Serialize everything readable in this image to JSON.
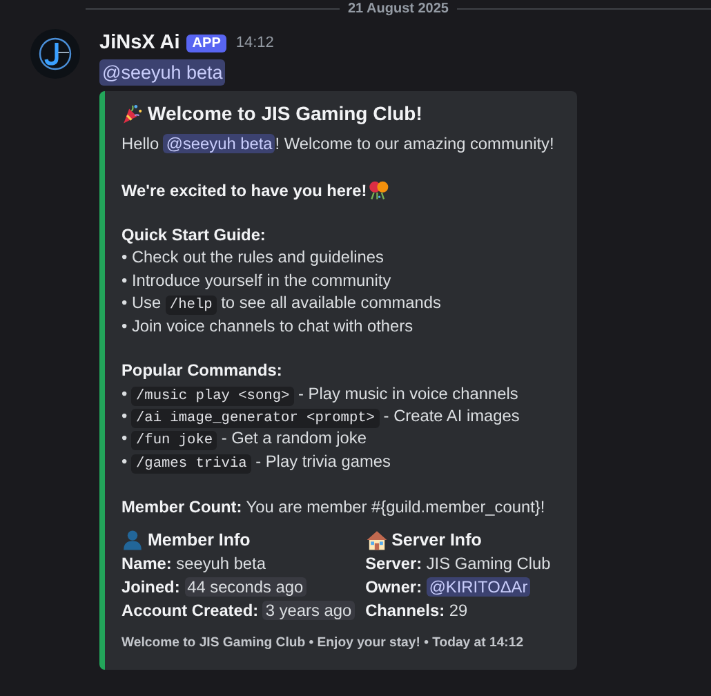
{
  "divider": {
    "date": "21 August 2025"
  },
  "message": {
    "author": "JiNsX Ai",
    "badge": "APP",
    "time": "14:12",
    "mention": "@seeyuh beta",
    "embed": {
      "title": "Welcome to JIS Gaming Club!",
      "lines": [
        {
          "kind": "line",
          "parts": [
            {
              "kind": "text",
              "text": "Hello "
            },
            {
              "kind": "mention",
              "text": "@seeyuh beta"
            },
            {
              "kind": "text",
              "text": "! Welcome to our amazing community!"
            }
          ]
        },
        {
          "kind": "gap"
        },
        {
          "kind": "line",
          "parts": [
            {
              "kind": "bold",
              "text": "We're excited to have you here!"
            },
            {
              "kind": "emoji"
            }
          ]
        },
        {
          "kind": "gap"
        },
        {
          "kind": "line",
          "parts": [
            {
              "kind": "bold",
              "text": "Quick Start Guide:"
            }
          ]
        },
        {
          "kind": "line",
          "parts": [
            {
              "kind": "text",
              "text": "• Check out the rules and guidelines"
            }
          ]
        },
        {
          "kind": "line",
          "parts": [
            {
              "kind": "text",
              "text": "• Introduce yourself in the community"
            }
          ]
        },
        {
          "kind": "line",
          "parts": [
            {
              "kind": "text",
              "text": "• Use "
            },
            {
              "kind": "code",
              "text": "/help"
            },
            {
              "kind": "text",
              "text": " to see all available commands"
            }
          ]
        },
        {
          "kind": "line",
          "parts": [
            {
              "kind": "text",
              "text": "• Join voice channels to chat with others"
            }
          ]
        },
        {
          "kind": "gap"
        },
        {
          "kind": "line",
          "parts": [
            {
              "kind": "bold",
              "text": "Popular Commands:"
            }
          ]
        },
        {
          "kind": "line",
          "parts": [
            {
              "kind": "text",
              "text": "• "
            },
            {
              "kind": "code",
              "text": "/music play <song>"
            },
            {
              "kind": "text",
              "text": " - Play music in voice channels"
            }
          ]
        },
        {
          "kind": "line",
          "parts": [
            {
              "kind": "text",
              "text": "• "
            },
            {
              "kind": "code",
              "text": "/ai image_generator <prompt>"
            },
            {
              "kind": "text",
              "text": " - Create AI images"
            }
          ]
        },
        {
          "kind": "line",
          "parts": [
            {
              "kind": "text",
              "text": "• "
            },
            {
              "kind": "code",
              "text": "/fun joke"
            },
            {
              "kind": "text",
              "text": " - Get a random joke"
            }
          ]
        },
        {
          "kind": "line",
          "parts": [
            {
              "kind": "text",
              "text": "• "
            },
            {
              "kind": "code",
              "text": "/games trivia"
            },
            {
              "kind": "text",
              "text": " - Play trivia games"
            }
          ]
        },
        {
          "kind": "gap"
        },
        {
          "kind": "line",
          "parts": [
            {
              "kind": "bold",
              "text": "Member Count:"
            },
            {
              "kind": "text",
              "text": " You are member #{guild.member_count}!"
            }
          ]
        }
      ],
      "fields": [
        {
          "name": "Member Info",
          "rows": [
            {
              "label": "Name:",
              "kind": "text",
              "value": "seeyuh beta"
            },
            {
              "label": "Joined:",
              "kind": "time",
              "value": "44 seconds ago"
            },
            {
              "label": "Account Created:",
              "kind": "time",
              "value": "3 years ago"
            }
          ]
        },
        {
          "name": "Server Info",
          "rows": [
            {
              "label": "Server:",
              "kind": "text",
              "value": "JIS Gaming Club"
            },
            {
              "label": "Owner:",
              "kind": "mention",
              "value": "@KIRITOΔAr"
            },
            {
              "label": "Channels:",
              "kind": "text",
              "value": "29"
            }
          ]
        }
      ],
      "footer": "Welcome to JIS Gaming Club • Enjoy your stay! • Today at 14:12"
    }
  }
}
